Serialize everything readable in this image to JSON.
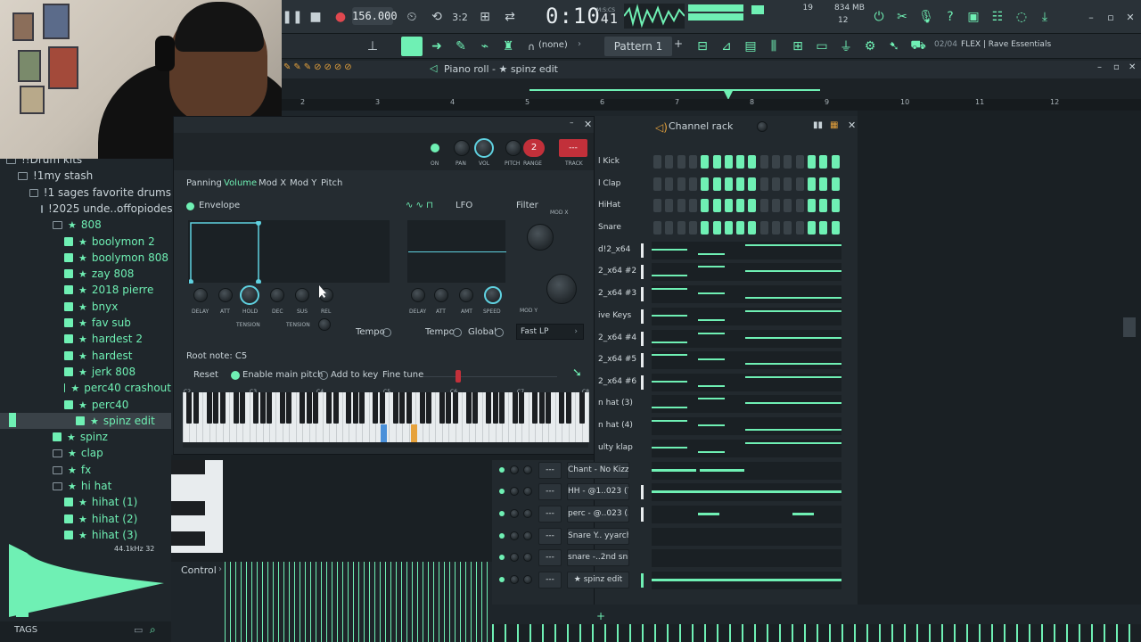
{
  "toolbar": {
    "tempo": "156.000",
    "time": "0:10",
    "time_fraction": "41",
    "time_label": "M:S:CS",
    "cpu_value": "19",
    "ram": "834 MB",
    "ram_sub": "12",
    "snap": "(none)",
    "pattern": "Pattern 1",
    "hint_counter": "02/04",
    "hint_text": "FLEX | Rave Essentials"
  },
  "browser": {
    "items": [
      {
        "label": "!!Drum kits",
        "kind": "folder",
        "indent": 1
      },
      {
        "label": "!1my stash",
        "kind": "folder",
        "indent": 2
      },
      {
        "label": "!1 sages favorite drums",
        "kind": "folder",
        "indent": 3
      },
      {
        "label": "!2025 unde..offopiodes",
        "kind": "folder",
        "indent": 4
      },
      {
        "label": "808",
        "kind": "fav-folder",
        "indent": 5
      },
      {
        "label": "boolymon 2",
        "kind": "fav-pack",
        "indent": 6
      },
      {
        "label": "boolymon 808",
        "kind": "fav-pack",
        "indent": 6
      },
      {
        "label": "zay 808",
        "kind": "fav-pack",
        "indent": 6
      },
      {
        "label": "2018 pierre",
        "kind": "fav-pack",
        "indent": 6
      },
      {
        "label": "bnyx",
        "kind": "fav-pack",
        "indent": 6
      },
      {
        "label": "fav sub",
        "kind": "fav-pack",
        "indent": 6
      },
      {
        "label": "hardest 2",
        "kind": "fav-pack",
        "indent": 6
      },
      {
        "label": "hardest",
        "kind": "fav-pack",
        "indent": 6
      },
      {
        "label": "jerk 808",
        "kind": "fav-pack",
        "indent": 6
      },
      {
        "label": "perc40 crashout",
        "kind": "fav-pack",
        "indent": 6
      },
      {
        "label": "perc40",
        "kind": "fav-pack",
        "indent": 6
      },
      {
        "label": "spinz edit",
        "kind": "fav-pack-sel",
        "indent": 7
      },
      {
        "label": "spinz",
        "kind": "fav-pack",
        "indent": 5
      },
      {
        "label": "clap",
        "kind": "fav-folder",
        "indent": 5
      },
      {
        "label": "fx",
        "kind": "fav-folder",
        "indent": 5
      },
      {
        "label": "hi hat",
        "kind": "fav-folder",
        "indent": 5
      },
      {
        "label": "hihat (1)",
        "kind": "fav-pack",
        "indent": 6
      },
      {
        "label": "hihat (2)",
        "kind": "fav-pack",
        "indent": 6
      },
      {
        "label": "hihat (3)",
        "kind": "fav-pack",
        "indent": 6
      }
    ],
    "sample_rate": "44.1kHz 32",
    "tags_label": "TAGS"
  },
  "piano_roll": {
    "title": "Piano roll - ★ spinz edit",
    "bars": [
      "2",
      "3",
      "4",
      "5",
      "6",
      "7",
      "8",
      "9",
      "10",
      "11",
      "12"
    ],
    "control_label": "Control"
  },
  "channel_settings": {
    "top_labels": {
      "on": "ON",
      "pan": "PAN",
      "vol": "VOL",
      "pitch": "PITCH",
      "range": "RANGE",
      "track": "TRACK"
    },
    "range_value": "2",
    "track_value": "---",
    "tabs": [
      "Panning",
      "Volume",
      "Mod X",
      "Mod Y",
      "Pitch"
    ],
    "envelope_label": "Envelope",
    "lfo_label": "LFO",
    "filter_label": "Filter",
    "mod_x_label": "MOD X",
    "mod_y_label": "MOD Y",
    "env_knobs": [
      "DELAY",
      "ATT",
      "HOLD",
      "DEC",
      "SUS",
      "REL"
    ],
    "tension_label": "TENSION",
    "lfo_knobs": [
      "DELAY",
      "ATT",
      "AMT",
      "SPEED"
    ],
    "tempo_label": "Tempo",
    "global_label": "Global",
    "filter_type": "Fast LP",
    "root_note": "Root note: C5",
    "reset_label": "Reset",
    "main_pitch_label": "Enable main pitch",
    "add_to_key_label": "Add to key",
    "fine_tune_label": "Fine tune",
    "octaves": [
      "C2",
      "C3",
      "C4",
      "C5",
      "C6",
      "C7",
      "C8"
    ]
  },
  "channel_rack": {
    "title": "Channel rack",
    "channels": [
      {
        "name": "l Kick"
      },
      {
        "name": "l Clap"
      },
      {
        "name": "HiHat"
      },
      {
        "name": "Snare"
      },
      {
        "name": "d!2_x64"
      },
      {
        "name": "2_x64 #2"
      },
      {
        "name": "2_x64 #3"
      },
      {
        "name": "ive Keys"
      },
      {
        "name": "2_x64 #4"
      },
      {
        "name": "2_x64 #5"
      },
      {
        "name": "2_x64 #6"
      },
      {
        "name": "n hat (3)"
      },
      {
        "name": "n hat (4)"
      },
      {
        "name": "ulty klap"
      }
    ],
    "lower_channels": [
      {
        "name": "Chant - No Kizzy"
      },
      {
        "name": "HH - @1..023 (7)"
      },
      {
        "name": "perc - @..023 (3)"
      },
      {
        "name": "Snare Y.. yyarche]"
      },
      {
        "name": "snare -..2nd snr"
      },
      {
        "name": "★ spinz edit"
      }
    ],
    "add_label": "+"
  },
  "colors": {
    "accent": "#6ff0b4",
    "panel": "#252c31",
    "highlight_blue": "#4a90d9",
    "highlight_orange": "#e6a23c"
  }
}
